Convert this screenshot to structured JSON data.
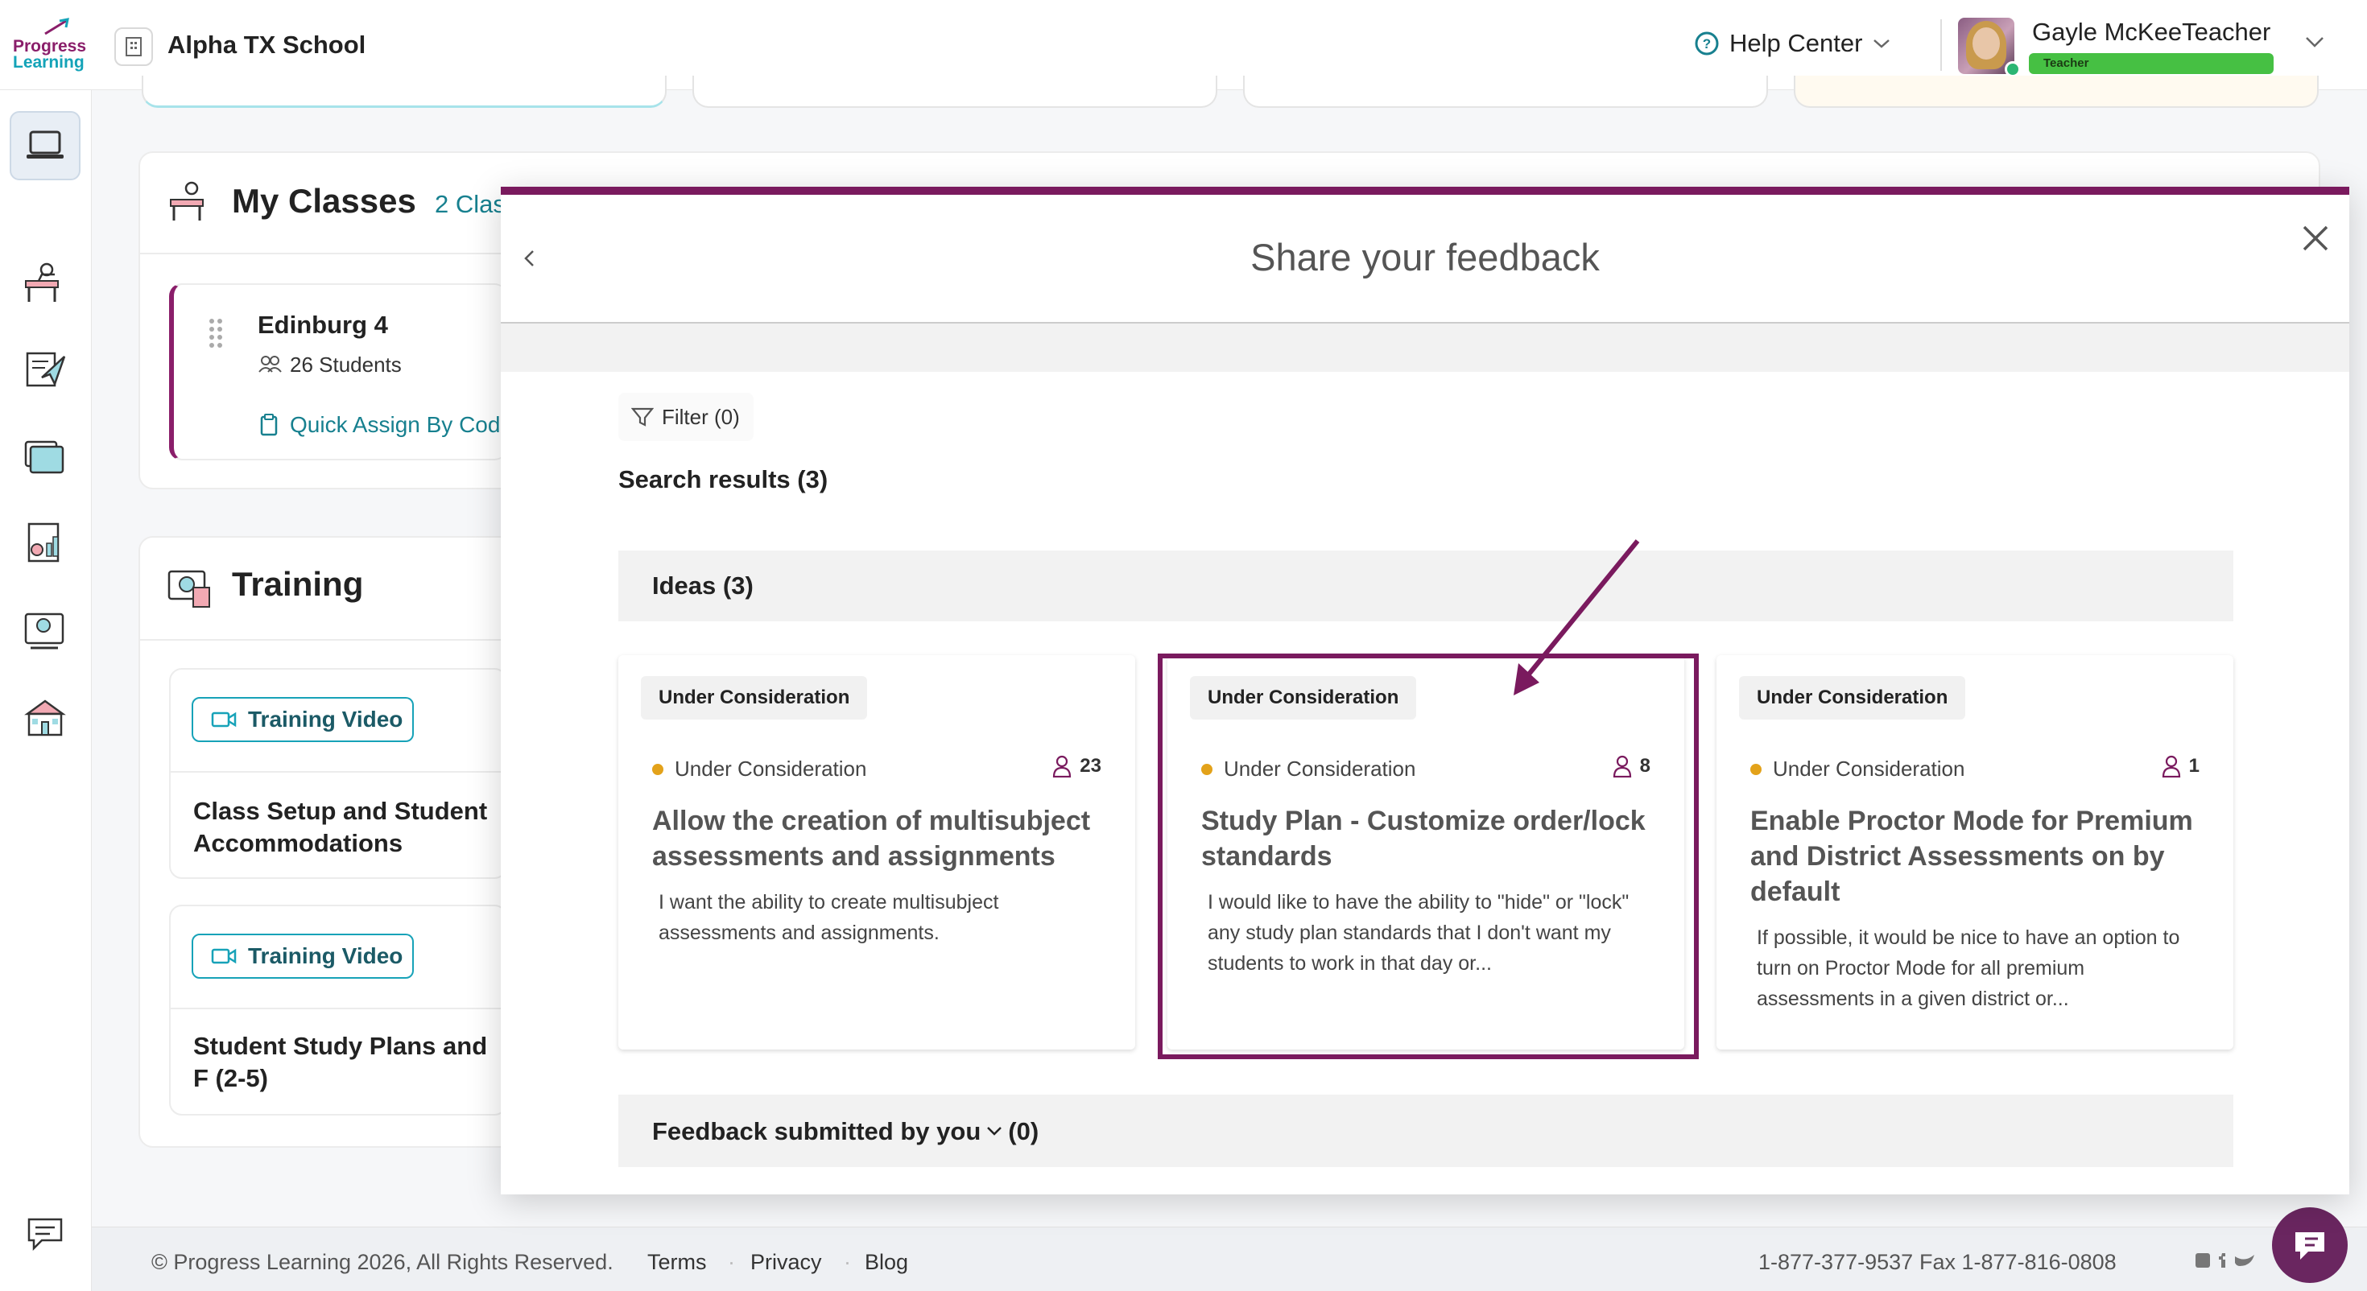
{
  "header": {
    "logo_line1": "Progress",
    "logo_line2": "Learning",
    "school_name": "Alpha TX School",
    "help_center": "Help Center",
    "user_name": "Gayle McKeeTeacher",
    "user_role": "Teacher"
  },
  "sidebar": {
    "items": [
      {
        "icon": "laptop-icon",
        "active": true
      },
      {
        "icon": "classroom-desk-icon",
        "active": false
      },
      {
        "icon": "assignment-send-icon",
        "active": false
      },
      {
        "icon": "folders-icon",
        "active": false
      },
      {
        "icon": "report-chart-icon",
        "active": false
      },
      {
        "icon": "training-board-icon",
        "active": false
      },
      {
        "icon": "school-building-icon",
        "active": false
      }
    ],
    "bottom_icon": "feedback-chat-icon"
  },
  "background": {
    "my_classes": {
      "title": "My Classes",
      "count": "2 Clas",
      "class_name": "Edinburg 4",
      "students": "26 Students",
      "quick_assign": "Quick Assign By Cod"
    },
    "training": {
      "title": "Training",
      "videos": [
        {
          "badge": "Training Video",
          "title": "Class Setup and Student Accommodations"
        },
        {
          "badge": "Training Video",
          "title": "Student Study Plans and F (2-5)"
        }
      ]
    }
  },
  "footer": {
    "copyright": "© Progress Learning 2026, All Rights Reserved.",
    "terms": "Terms",
    "privacy": "Privacy",
    "blog": "Blog",
    "phone": "1-877-377-9537",
    "fax": "Fax 1-877-816-0808",
    "sep": "·"
  },
  "modal": {
    "title": "Share your feedback",
    "filter_label": "Filter (0)",
    "search_results": "Search results (3)",
    "ideas_label": "Ideas (3)",
    "ideas": [
      {
        "tag": "Under Consideration",
        "status": "Under Consideration",
        "votes": "23",
        "title": "Allow the creation of multisubject assessments and assignments",
        "description": "I want the ability to create multisubject assessments and assignments."
      },
      {
        "tag": "Under Consideration",
        "status": "Under Consideration",
        "votes": "8",
        "title": "Study Plan - Customize order/lock standards",
        "description": "I would like to have the ability to \"hide\" or \"lock\" any study plan standards that I don't want my students to work in that day or..."
      },
      {
        "tag": "Under Consideration",
        "status": "Under Consideration",
        "votes": "1",
        "title": "Enable Proctor Mode for Premium and District Assessments on by default",
        "description": "If possible, it would be nice to have an option to turn on Proctor Mode for all premium assessments in a given district or..."
      }
    ],
    "feedback_by_you": "Feedback submitted by you",
    "feedback_count": "(0)"
  },
  "colors": {
    "brand_purple": "#7a1a5e",
    "teal": "#17808f",
    "status_dot": "#e3a21a",
    "role_green": "#46c043"
  }
}
